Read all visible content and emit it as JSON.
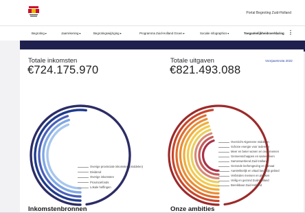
{
  "header": {
    "logo_icon": "provincie-zuid-holland-crest",
    "portal_link": "Portal Begroting Zuid-Holland"
  },
  "nav": {
    "items": [
      {
        "label": "Begroting",
        "has_menu": true
      },
      {
        "label": "Jaarrekening",
        "has_menu": true
      },
      {
        "label": "Begrotingswijziging",
        "has_menu": true
      },
      {
        "label": "Programma Zuid-Holland Groen",
        "has_menu": true
      },
      {
        "label": "Sociale infographics",
        "has_menu": true
      },
      {
        "label": "Toegankelijkheidsverklaring",
        "has_menu": false
      }
    ],
    "more_icon": "vertical-dots-icon"
  },
  "income": {
    "title": "Totale inkomsten",
    "amount": "€724.175.970",
    "legend": [
      "Overige provinciale inkomsten (middelen)",
      "Dividend",
      "Overige inkomsten",
      "Provinciefonds",
      "Lokale heffingen"
    ],
    "ring_colors": [
      "#2c2c66",
      "#1f3b8c",
      "#4b5fb8",
      "#7fa8e4",
      "#a9c6ee"
    ],
    "ring_fill": [
      0.73,
      0.27,
      0.2,
      0.2,
      0.19
    ]
  },
  "expenses": {
    "title": "Totale uitgaven",
    "amount": "€821.493.088",
    "year_link": "Voorjaarsnota 2022",
    "legend": [
      "Overzicht Algemene middelen",
      "Schone energie voor iedereen",
      "Meer en beter wonen en ondernemen",
      "Gemeenschappen en samenleven",
      "Samenwerkend Zuid-Holland",
      "Gezonde leefomgeving en klimaat",
      "Aantrekkelijk en vitaal landelijk gebied",
      "Verbinden mensen en plekken",
      "Veilig en gezond Zuid-Holland",
      "Bereikbaar Zuid-Holland"
    ],
    "ring_colors": [
      "#9c2a2a",
      "#c8462c",
      "#df6c2e",
      "#e88d36",
      "#f0ad3d",
      "#f5c94e",
      "#e9cf5e",
      "#d88a78",
      "#c45a5a",
      "#a8324a"
    ],
    "ring_fill": [
      0.73,
      0.23,
      0.2,
      0.2,
      0.2,
      0.2,
      0.2,
      0.2,
      0.2,
      0.2
    ]
  },
  "sections": {
    "left": "Inkomstenbronnen",
    "right": "Onze ambities"
  }
}
